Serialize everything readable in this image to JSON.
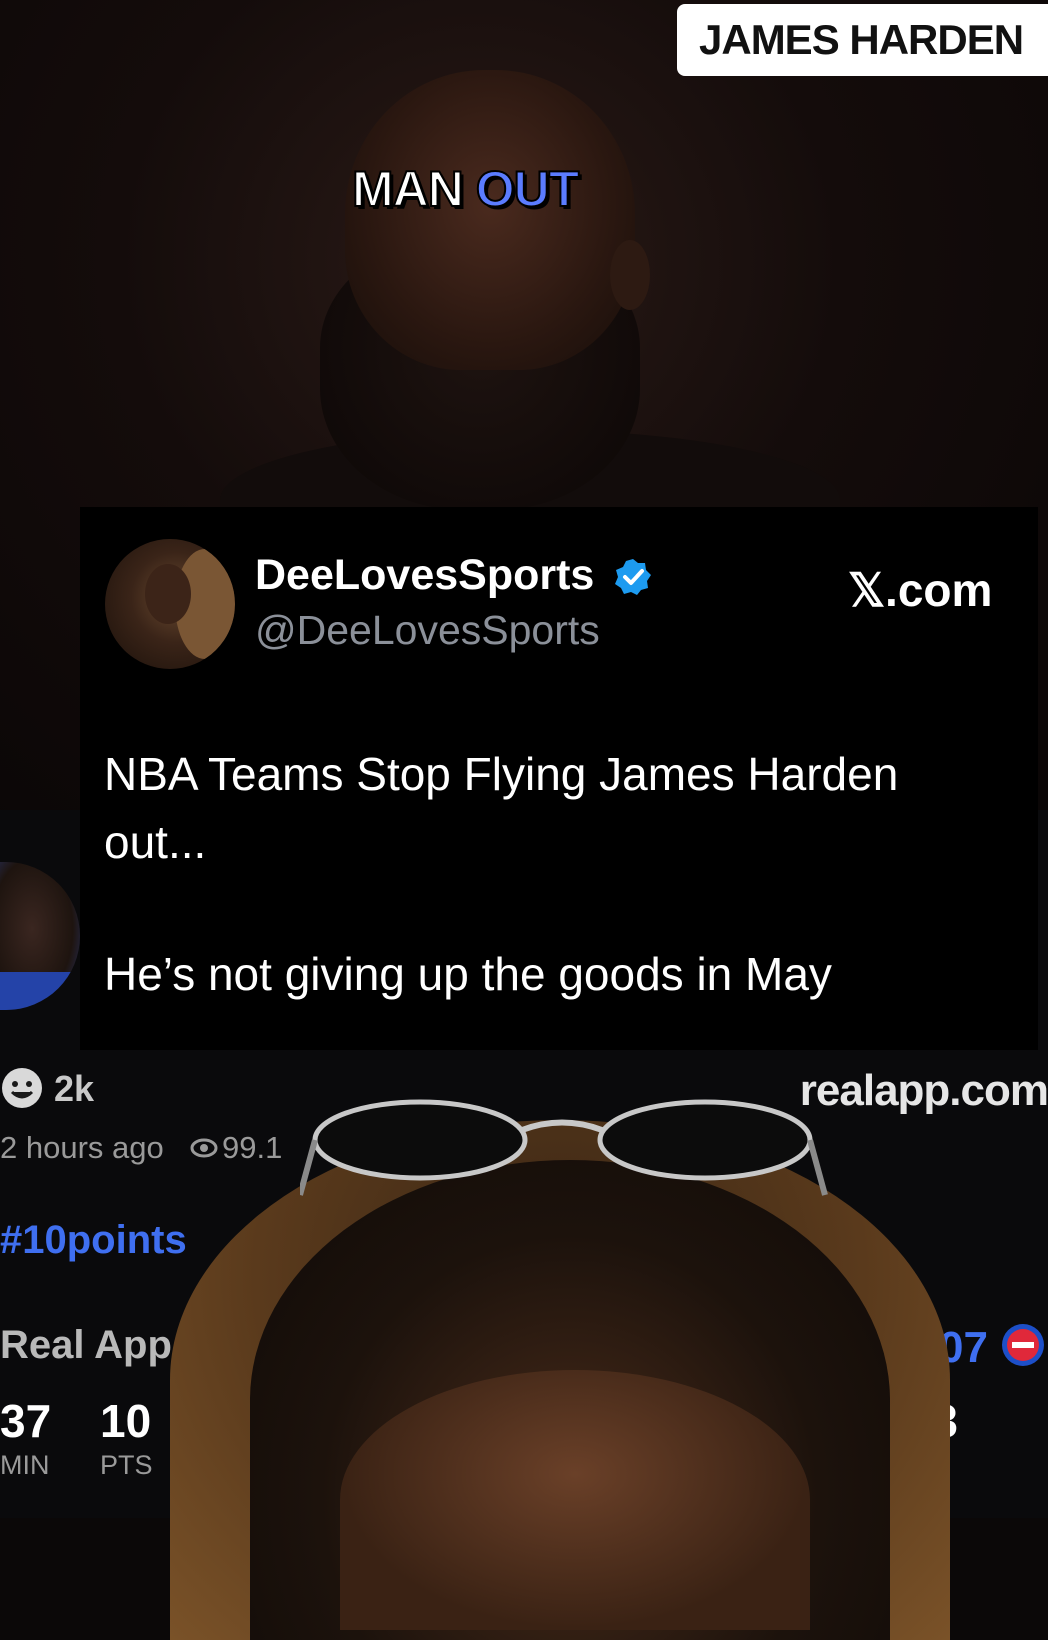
{
  "video_overlay": {
    "name_tag": "JAMES HARDEN",
    "caption_words": [
      "MAN",
      "OUT"
    ]
  },
  "tweet": {
    "display_name": "DeeLovesSports",
    "handle": "@DeeLovesSports",
    "source": "𝕏.com",
    "verified": true,
    "text_lines": [
      "NBA Teams Stop Flying James Harden",
      "out...",
      "He’s not giving up the goods in May"
    ]
  },
  "app_post": {
    "reaction_count": "2k",
    "watermark": "realapp.com",
    "timestamp": "2 hours ago",
    "views": "99.1",
    "hashtag": "#10points",
    "app_name": "Real App ·",
    "score": "-107",
    "stats": [
      {
        "value": "37",
        "label": "MIN"
      },
      {
        "value": "10",
        "label": "PTS"
      }
    ],
    "stat_extra": "3",
    "icons": {
      "reaction": "smiley-icon",
      "views": "eye-icon",
      "team": "team-logo-icon",
      "verified": "verified-badge-icon"
    },
    "colors": {
      "accent_blue": "#3f6ff0",
      "verified_blue": "#1d9bf0",
      "caption_blue": "#5b7cff"
    }
  }
}
